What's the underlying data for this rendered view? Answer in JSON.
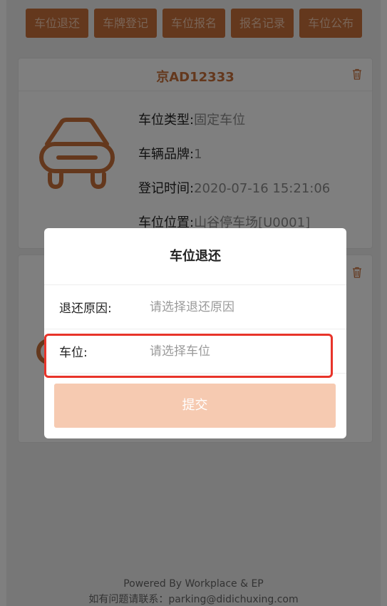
{
  "tabs": [
    "车位退还",
    "车牌登记",
    "车位报名",
    "报名记录",
    "车位公布"
  ],
  "cards": [
    {
      "plate": "京AD12333",
      "fields": [
        {
          "label": "车位类型:",
          "value": "固定车位"
        },
        {
          "label": "车辆品牌:",
          "value": "1"
        },
        {
          "label": "登记时间:",
          "value": "2020-07-16 15:21:06"
        },
        {
          "label": "车位位置:",
          "value": "山谷停车场[U0001]"
        }
      ]
    }
  ],
  "footer": {
    "powered": "Powered By Workplace & EP",
    "contact": "如有问题请联系：parking@didichuxing.com"
  },
  "modal": {
    "title": "车位退还",
    "reason_label": "退还原因:",
    "reason_placeholder": "请选择退还原因",
    "spot_label": "车位:",
    "spot_placeholder": "请选择车位",
    "submit_label": "提交"
  },
  "colors": {
    "accent": "#c8703a",
    "button_disabled": "#f6cab1",
    "highlight": "#e8342a"
  },
  "icons": [
    "car-icon",
    "trash-icon"
  ]
}
